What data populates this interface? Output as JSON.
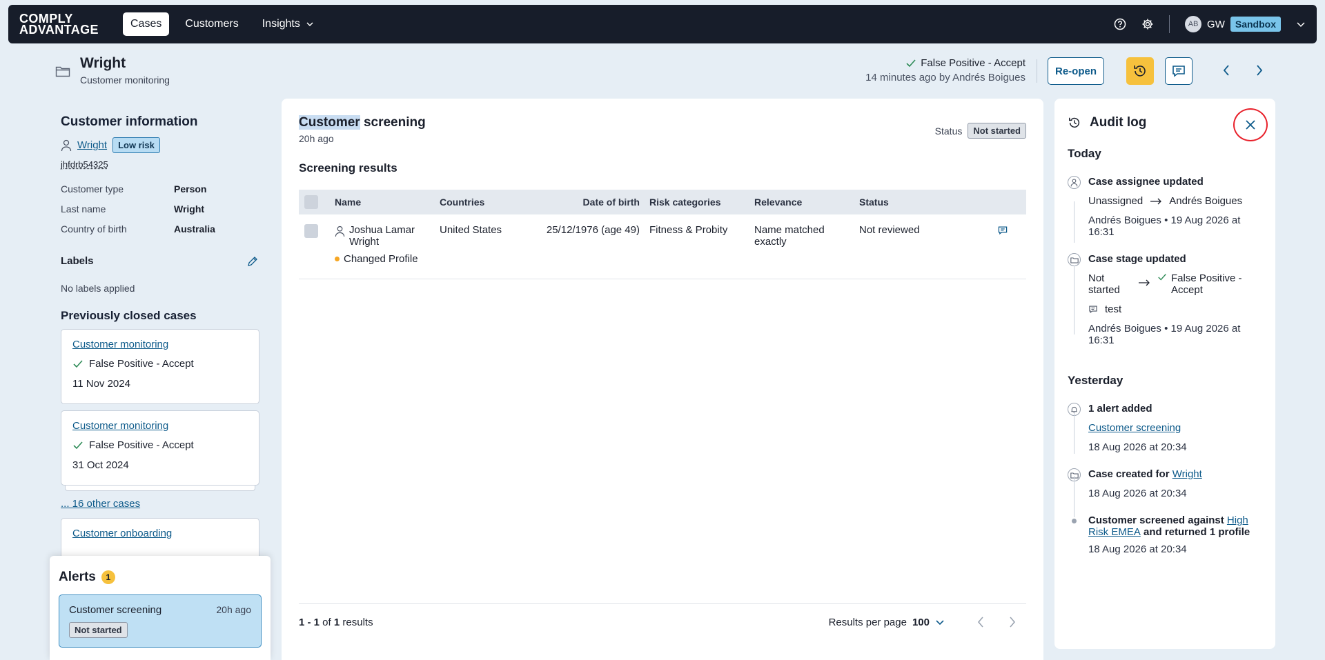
{
  "nav": {
    "logo_line1": "COMPLY",
    "logo_line2": "ADVANTAGE",
    "tabs": [
      {
        "label": "Cases"
      },
      {
        "label": "Customers"
      },
      {
        "label": "Insights"
      }
    ],
    "user_initials": "AB",
    "user_short": "GW",
    "env_badge": "Sandbox"
  },
  "case": {
    "title": "Wright",
    "subtitle": "Customer monitoring",
    "outcome": "False Positive - Accept",
    "outcome_meta": "14 minutes ago by Andrés Boigues",
    "reopen_label": "Re-open"
  },
  "customer": {
    "heading": "Customer information",
    "name": "Wright",
    "risk": "Low risk",
    "id": "jhfdrb54325",
    "fields": [
      {
        "key": "Customer type",
        "value": "Person"
      },
      {
        "key": "Last name",
        "value": "Wright"
      },
      {
        "key": "Country of birth",
        "value": "Australia"
      }
    ],
    "labels_title": "Labels",
    "no_labels": "No labels applied"
  },
  "previous": {
    "heading": "Previously closed cases",
    "cases": [
      {
        "title": "Customer monitoring",
        "status": "False Positive - Accept",
        "date": "11 Nov 2024"
      },
      {
        "title": "Customer monitoring",
        "status": "False Positive - Accept",
        "date": "31 Oct 2024"
      }
    ],
    "others_link": "... 16 other cases",
    "onboarding_title": "Customer onboarding"
  },
  "alerts": {
    "heading": "Alerts",
    "count": "1",
    "item": {
      "title": "Customer screening",
      "time": "20h ago",
      "status": "Not started"
    }
  },
  "screening": {
    "title_hl": "Customer",
    "title_rest": " screening",
    "time": "20h ago",
    "status_label": "Status",
    "status": "Not started",
    "results_heading": "Screening results",
    "columns": [
      "Name",
      "Countries",
      "Date of birth",
      "Risk categories",
      "Relevance",
      "Status"
    ],
    "rows": [
      {
        "name": "Joshua Lamar Wright",
        "tag": "Changed Profile",
        "countries": "United States",
        "dob": "25/12/1976 (age 49)",
        "risk": "Fitness & Probity",
        "relevance": "Name matched exactly",
        "status": "Not reviewed"
      }
    ],
    "footer": {
      "range": "1 - 1",
      "of": " of ",
      "total": "1",
      "suffix": " results",
      "rpp_label": "Results per page",
      "rpp_value": "100"
    }
  },
  "audit": {
    "heading": "Audit log",
    "today_label": "Today",
    "yesterday_label": "Yesterday",
    "today": [
      {
        "title": "Case assignee updated",
        "from": "Unassigned",
        "to": "Andrés Boigues",
        "meta": "Andrés Boigues • 19 Aug 2026 at 16:31"
      },
      {
        "title": "Case stage updated",
        "from": "Not started",
        "to": "False Positive - Accept",
        "comment": "test",
        "meta": "Andrés Boigues • 19 Aug 2026 at 16:31"
      }
    ],
    "yesterday": [
      {
        "title": "1 alert added",
        "link": "Customer screening",
        "meta": "18 Aug 2026 at 20:34"
      },
      {
        "title": "Case created for ",
        "link": "Wright",
        "meta": "18 Aug 2026 at 20:34"
      },
      {
        "title": "Customer screened against ",
        "link": "High Risk EMEA",
        "suffix": " and returned 1 profile",
        "meta": "18 Aug 2026 at 20:34"
      }
    ]
  }
}
